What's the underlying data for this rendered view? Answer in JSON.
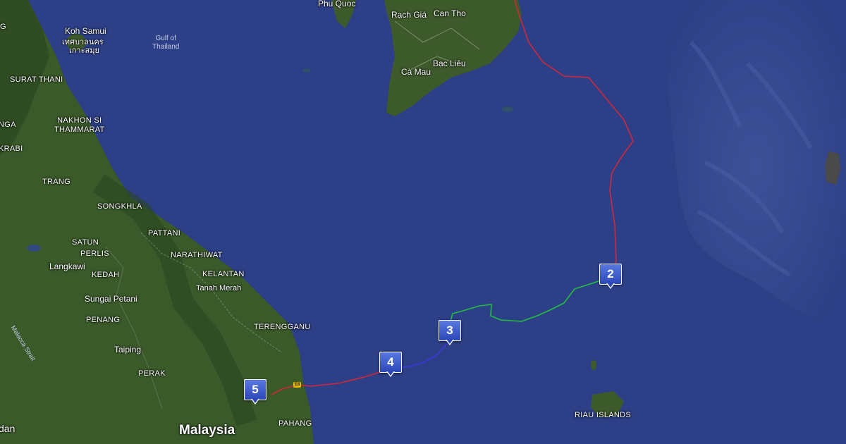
{
  "map": {
    "colors": {
      "sea": "#2d3f86",
      "land": "#3a5a2a",
      "route_red": "#d0283a",
      "route_green": "#22c040",
      "route_blue": "#3838e0",
      "marker": "#3a58cc"
    },
    "labels": {
      "phu_quoc": "Phu Quoc",
      "rach_gia": "Rạch Giá",
      "can_tho": "Can Tho",
      "ca_mau": "Cà Mau",
      "bac_lieu": "Bạc Liêu",
      "koh_samui": "Koh Samui",
      "koh_samui_thai": "เกาะสมุย",
      "koh_samui_thai2": "เทศบาลนคร",
      "gulf_of_thailand": "Gulf of\nThailand",
      "surat_thani": "SURAT THANI",
      "nakhon_si_thammarat": "NAKHON SI\nTHAMMARAT",
      "krabi": "KRABI",
      "nga": "NGA",
      "trang": "TRANG",
      "songkhla": "SONGKHLA",
      "pattani": "PATTANI",
      "satun": "SATUN",
      "perlis": "PERLIS",
      "narathiwat": "NARATHIWAT",
      "langkawi": "Langkawi",
      "kedah": "KEDAH",
      "kelantan": "KELANTAN",
      "tanah_merah": "Tanah Merah",
      "sungai_petani": "Sungai Petani",
      "penang": "PENANG",
      "terengganu": "TERENGGANU",
      "taiping": "Taiping",
      "perak": "PERAK",
      "malaysia": "Malaysia",
      "pahang": "PAHANG",
      "riau_islands": "RIAU ISLANDS",
      "malacca_strait": "Malacca Strait",
      "edge_dan": "dan",
      "edge_g": "G",
      "road_e8": "E8"
    },
    "markers": [
      {
        "number": "2",
        "name": "waypoint-2"
      },
      {
        "number": "3",
        "name": "waypoint-3"
      },
      {
        "number": "4",
        "name": "waypoint-4"
      },
      {
        "number": "5",
        "name": "waypoint-5"
      }
    ]
  }
}
